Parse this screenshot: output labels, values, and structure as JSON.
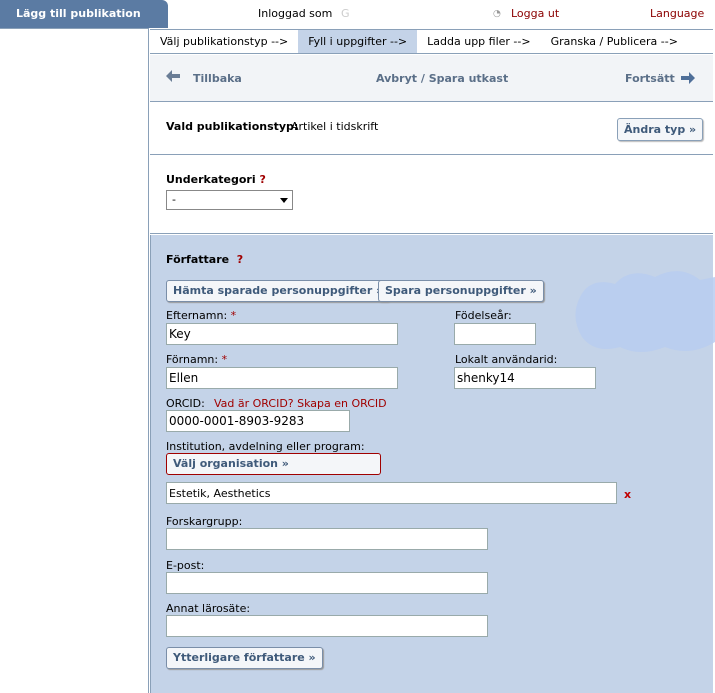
{
  "sidebar": {
    "tab_label": "Lägg till publikation"
  },
  "top": {
    "logged_in_label": "Inloggad som",
    "logged_in_user": "G",
    "logout": "Logga ut",
    "language": "Language"
  },
  "steps": [
    {
      "label": "Välj publikationstyp -->",
      "active": false
    },
    {
      "label": "Fyll i uppgifter -->",
      "active": true
    },
    {
      "label": "Ladda upp filer -->",
      "active": false
    },
    {
      "label": "Granska / Publicera -->",
      "active": false
    }
  ],
  "nav": {
    "back": "Tillbaka",
    "middle": "Avbryt / Spara utkast",
    "forward": "Fortsätt"
  },
  "pubtype": {
    "label": "Vald publikationstyp:",
    "value": "Artikel i tidskrift",
    "change_button": "Ändra typ »"
  },
  "subcategory": {
    "label": "Underkategori",
    "help": "?",
    "selected": "-"
  },
  "authors": {
    "label": "Författare",
    "help": "?",
    "fetch_button": "Hämta sparade personuppgifter »",
    "save_button": "Spara personuppgifter »",
    "last_name_label": "Efternamn:",
    "last_name_value": "Key",
    "required_mark": "*",
    "birth_year_label": "Födelseår:",
    "birth_year_value": "",
    "first_name_label": "Förnamn:",
    "first_name_value": "Ellen",
    "local_id_label": "Lokalt användarid:",
    "local_id_value": "shenky14",
    "orcid_label": "ORCID:",
    "orcid_links": "Vad är ORCID? Skapa en ORCID",
    "orcid_value": "0000-0001-8903-9283",
    "institution_label": "Institution, avdelning eller program:",
    "select_org_button": "Välj organisation »",
    "institution_value": "Estetik, Aesthetics",
    "remove_mark": "x",
    "research_group_label": "Forskargrupp:",
    "research_group_value": "",
    "email_label": "E-post:",
    "email_value": "",
    "other_uni_label": "Annat lärosäte:",
    "other_uni_value": "",
    "more_authors_button": "Ytterligare författare »"
  }
}
